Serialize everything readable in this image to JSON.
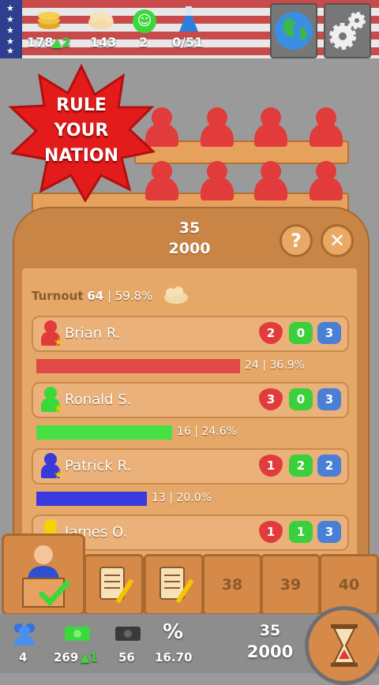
{
  "top_stats": {
    "coins": "178",
    "coins_delta": "2",
    "food": "143",
    "happiness": "2",
    "research": "0/51"
  },
  "badge_text": [
    "RULE",
    "YOUR",
    "NATION"
  ],
  "panel": {
    "number": "35",
    "budget": "2000",
    "help_label": "?",
    "close_label": "✕",
    "turnout_label": "Turnout",
    "turnout_value": "64",
    "turnout_pct": "| 59.8%"
  },
  "candidates": [
    {
      "name": "Brian R.",
      "color": "#e23b3b",
      "hearts": "2",
      "green": "0",
      "hands": "3",
      "votes": "24",
      "pct": "| 36.9%",
      "share": 0.369
    },
    {
      "name": "Ronald S.",
      "color": "#3bd83b",
      "hearts": "3",
      "green": "0",
      "hands": "3",
      "votes": "16",
      "pct": "| 24.6%",
      "share": 0.246
    },
    {
      "name": "Patrick R.",
      "color": "#3a3ad8",
      "hearts": "1",
      "green": "2",
      "hands": "2",
      "votes": "13",
      "pct": "| 20.0%",
      "share": 0.2
    },
    {
      "name": "James O.",
      "color": "#f5d300",
      "hearts": "1",
      "green": "1",
      "hands": "3"
    }
  ],
  "tiles": [
    "38",
    "39",
    "40"
  ],
  "bottom_stats": {
    "population": "4",
    "money": "269",
    "money_delta": "1",
    "debt": "56",
    "rate": "16.70",
    "rate_symbol": "%",
    "turn": "35",
    "budget": "2000"
  },
  "colors": {
    "panel": "#c98545",
    "inner": "#e6a869",
    "accent": "#e23b3b"
  }
}
